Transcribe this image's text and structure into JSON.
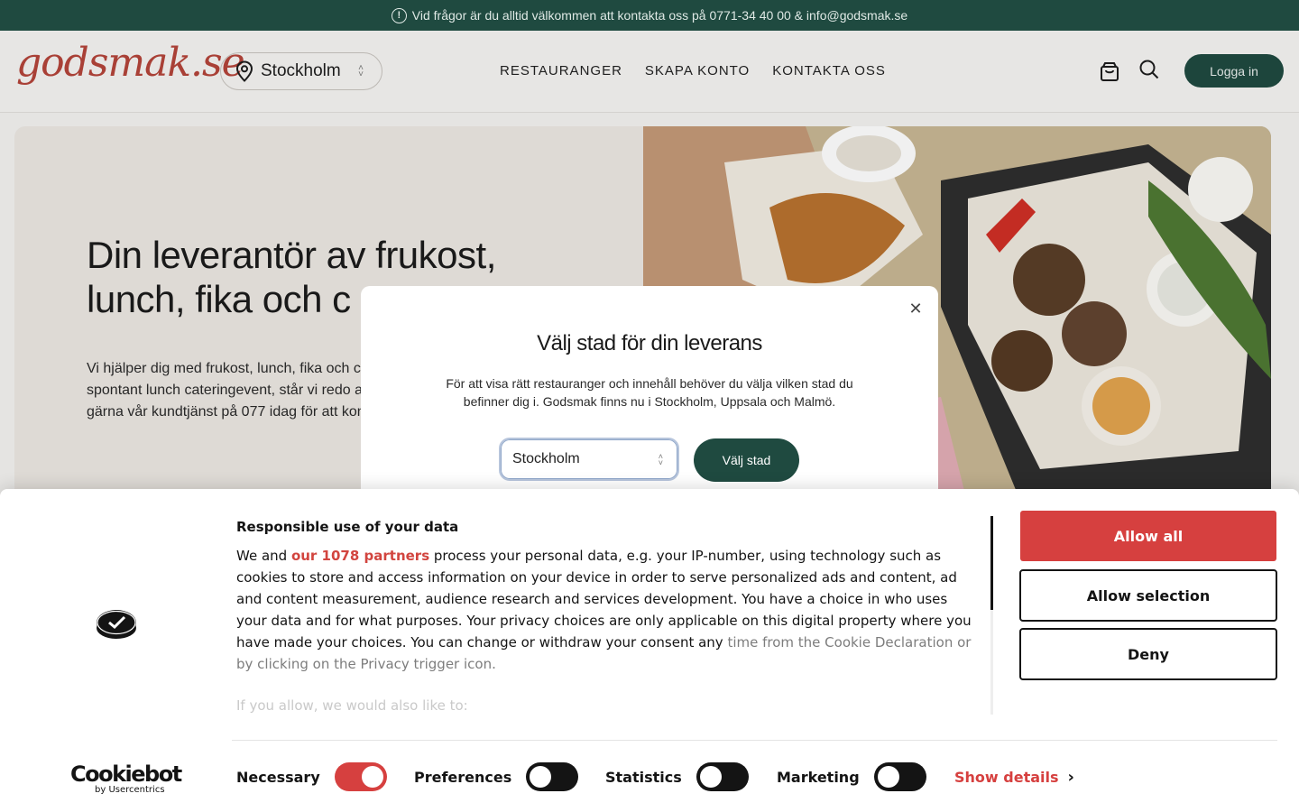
{
  "topbar": {
    "icon": "info-circle-icon",
    "text": "Vid frågor är du alltid välkommen att kontakta oss på 0771-34 40 00 & info@godsmak.se"
  },
  "header": {
    "logo": "godsmak.se",
    "city": "Stockholm",
    "nav": [
      "RESTAURANGER",
      "SKAPA KONTO",
      "KONTAKTA OSS"
    ],
    "login": "Logga in"
  },
  "hero": {
    "title": "Din leverantör av frukost, lunch, fika och c",
    "text": "Vi hjälper dig med frukost, lunch, fika och ca kontor. Oavsett om ni har ett spontant lunch cateringevent, står vi redo att ge personlig s era behov. Ring gärna vår kundtjänst på 077 idag för att komma igång."
  },
  "modal": {
    "title": "Välj stad för din leverans",
    "text": "För att visa rätt restauranger och innehåll behöver du välja vilken stad du befinner dig i. Godsmak finns nu i Stockholm, Uppsala och Malmö.",
    "select_value": "Stockholm",
    "button": "Välj stad"
  },
  "cookie": {
    "title": "Responsible use of your data",
    "body_before": "We and ",
    "partners_link": "our 1078 partners",
    "body_after": " process your personal data, e.g. your IP-number, using technology such as cookies to store and access information on your device in order to serve personalized ads and content, ad and content measurement, audience research and services development. You have a choice in who uses your data and for what purposes. Your privacy choices are only applicable on this digital property where you have made your choices. You can change or withdraw your consent any ",
    "body_faded": "time from the Cookie Declaration or by clicking on the Privacy trigger icon.",
    "also": "If you allow, we would also like to:",
    "allow_all": "Allow all",
    "allow_selection": "Allow selection",
    "deny": "Deny",
    "brand_name": "Cookiebot",
    "brand_by": "by Usercentrics",
    "toggles": [
      {
        "label": "Necessary",
        "on": true
      },
      {
        "label": "Preferences",
        "on": false
      },
      {
        "label": "Statistics",
        "on": false
      },
      {
        "label": "Marketing",
        "on": false
      }
    ],
    "show_details": "Show details",
    "accent": "#d6403f"
  },
  "colors": {
    "brand_green": "#1f4a40",
    "logo_red": "#b4453a"
  }
}
